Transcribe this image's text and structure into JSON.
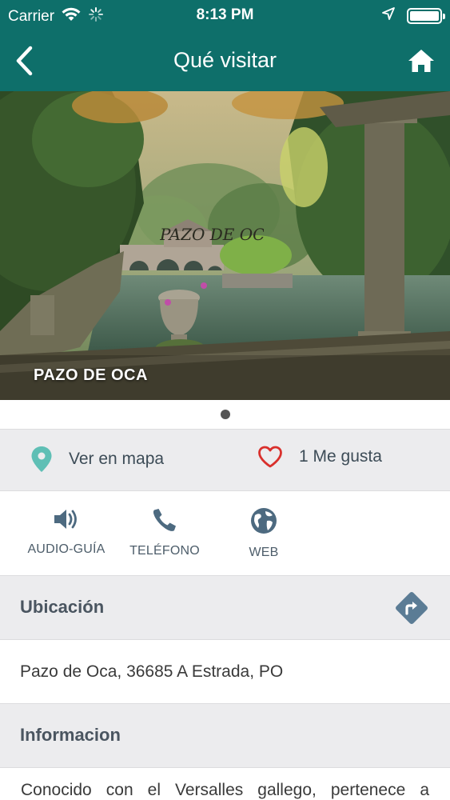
{
  "status_bar": {
    "carrier": "Carrier",
    "time": "8:13 PM"
  },
  "nav": {
    "title": "Qué visitar"
  },
  "hero": {
    "caption": "PAZO DE OCA",
    "watermark": "PAZO DE OCA",
    "page_count": 1,
    "current_page": 1
  },
  "actions": {
    "map_label": "Ver en mapa",
    "like_label": "1 Me gusta"
  },
  "tools": {
    "audio_label": "AUDIO-GUÍA",
    "phone_label": "TELÉFONO",
    "web_label": "WEB"
  },
  "location": {
    "title": "Ubicación",
    "address": "Pazo de Oca, 36685 A Estrada, PO"
  },
  "information": {
    "title": "Informacion",
    "text": "Conocido con el Versalles gallego, pertenece a"
  },
  "colors": {
    "header_bg": "#0e6f6a",
    "map_pin": "#5fbfb5",
    "heart": "#d9302c",
    "icon_slate": "#4d6a80",
    "route_diamond": "#5b7c95"
  },
  "icons": {
    "back": "chevron-left-icon",
    "home": "home-icon",
    "map": "map-pin-icon",
    "like": "heart-icon",
    "audio": "speaker-icon",
    "phone": "phone-icon",
    "web": "globe-icon",
    "route": "directions-icon"
  }
}
